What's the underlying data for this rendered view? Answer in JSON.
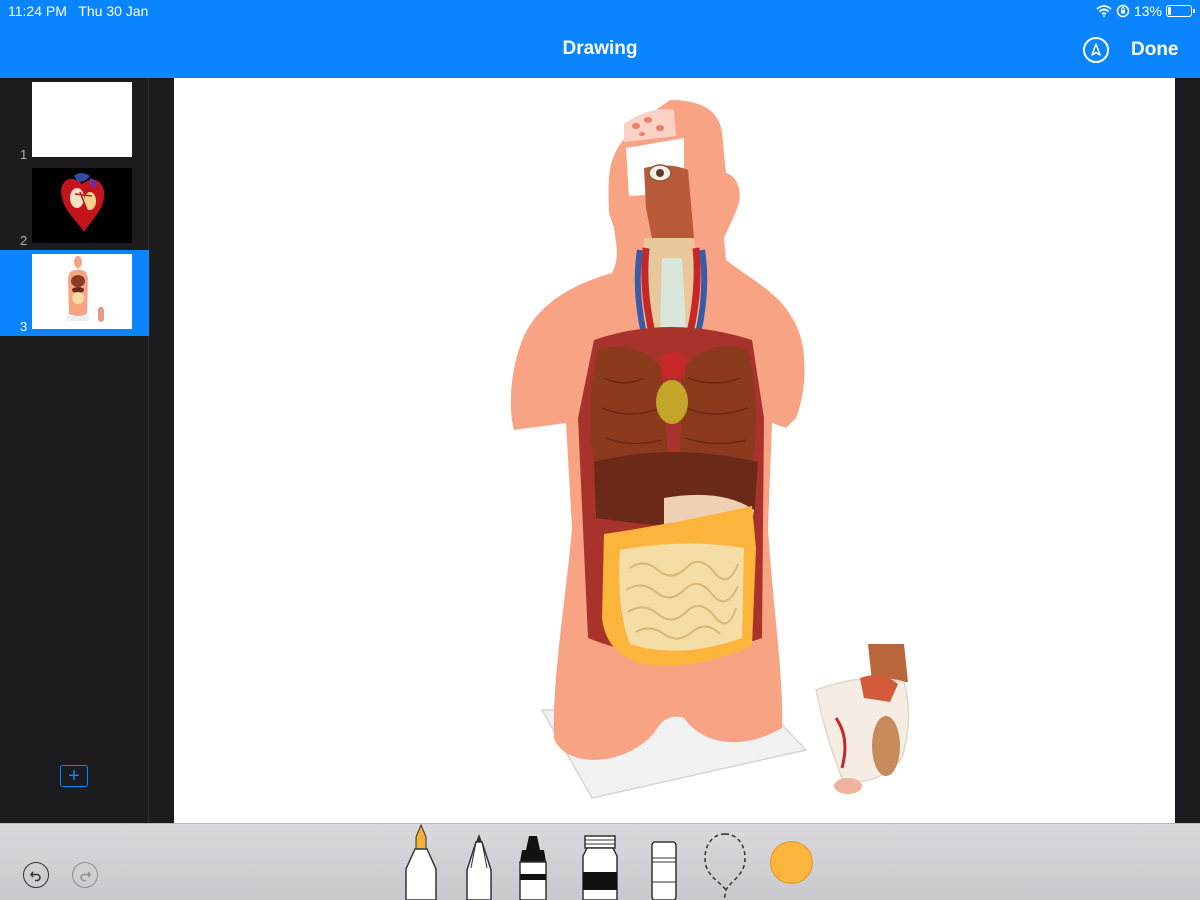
{
  "status": {
    "time": "11:24 PM   Thu 30 Jan",
    "battery_text": "13%",
    "battery_level": 0.13
  },
  "nav": {
    "title": "Drawing",
    "done_label": "Done"
  },
  "sidebar": {
    "slides": [
      {
        "number": "1",
        "selected": false
      },
      {
        "number": "2",
        "selected": false
      },
      {
        "number": "3",
        "selected": true
      }
    ]
  },
  "toolbar": {
    "tools": [
      "pen-icon",
      "pencil-icon",
      "marker-icon",
      "paint-tube-icon",
      "eraser-icon",
      "lasso-icon"
    ],
    "current_color": "#fdb43d"
  },
  "colors": {
    "accent": "#0a84ff",
    "skin": "#f9a385",
    "sidebar_bg": "#1c1c1e"
  }
}
